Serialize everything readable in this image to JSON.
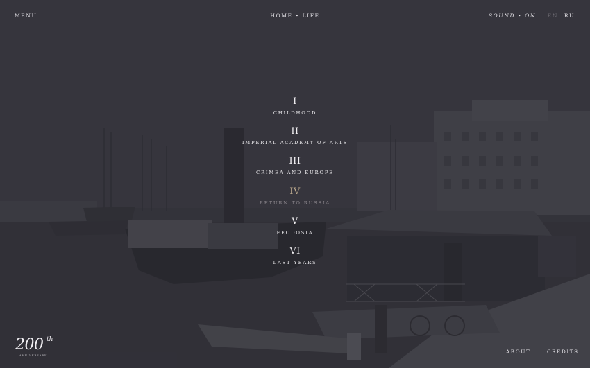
{
  "header": {
    "menu_label": "MENU",
    "breadcrumb": "HOME • LIFE",
    "sound_label": "SOUND • ON",
    "languages": [
      {
        "code": "EN",
        "active": false
      },
      {
        "code": "RU",
        "active": true
      }
    ]
  },
  "chapters": [
    {
      "numeral": "I",
      "title": "CHILDHOOD"
    },
    {
      "numeral": "II",
      "title": "IMPERIAL ACADEMY OF ARTS"
    },
    {
      "numeral": "III",
      "title": "CRIMEA AND EUROPE"
    },
    {
      "numeral": "IV",
      "title": "RETURN TO RUSSIA",
      "state": "muted"
    },
    {
      "numeral": "V",
      "title": "FEODOSIA"
    },
    {
      "numeral": "VI",
      "title": "LAST YEARS"
    }
  ],
  "logo": {
    "number": "200",
    "suffix": "th",
    "subtitle": "ANNIVERSARY"
  },
  "footer": {
    "about_label": "ABOUT",
    "credits_label": "CREDITS"
  },
  "colors": {
    "background": "#38373f",
    "text": "#e8e6ea",
    "muted_numeral": "#b9a78c",
    "inactive_language": "#6d6a72"
  }
}
